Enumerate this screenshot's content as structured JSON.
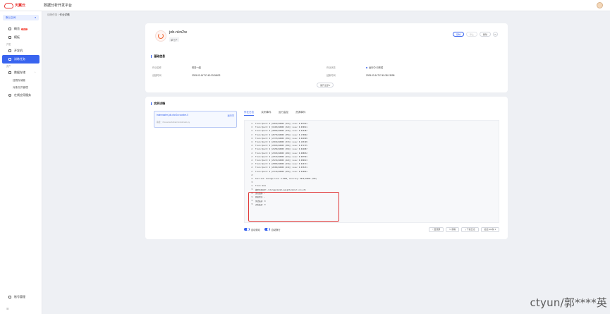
{
  "app": {
    "logo_text": "天翼云",
    "title": "数据分析开发平台"
  },
  "sidebar": {
    "workspace": "默认空间",
    "items": [
      {
        "label": "概览",
        "badge": "NEW",
        "active": false
      },
      {
        "label": "模板",
        "active": false
      },
      {
        "group": "开发"
      },
      {
        "label": "开发机",
        "active": false
      },
      {
        "label": "训练任务",
        "active": true
      },
      {
        "group": "资产"
      },
      {
        "label": "数据存储",
        "active": false,
        "expandable": true
      },
      {
        "sub": "挂载存储卷"
      },
      {
        "sub": "对象文件管理"
      },
      {
        "label": "在线应用服务",
        "active": false
      }
    ],
    "bottom_item": "账号管理",
    "collapse_label": "收起"
  },
  "breadcrumb": {
    "parent": "训练任务",
    "separator": "/",
    "current": "作业详情"
  },
  "job": {
    "name": "job-nkn2w",
    "tag": "单门户",
    "actions": {
      "copy": "复制",
      "stop": "停止",
      "delete": "删除"
    }
  },
  "basic_info": {
    "title": "基础信息",
    "rows": [
      {
        "k1": "作业名称",
        "v1": "任务一组",
        "k2": "作业状态",
        "v2": "运行中·已完成"
      },
      {
        "k1": "创建时间",
        "v1": "2025-03-14T17:43:33.08632",
        "k2": "结束时间",
        "v2": "2025-03-14T17:45:38.13098"
      }
    ],
    "expand_label": "展开全部"
  },
  "detail": {
    "title": "实例详情",
    "instance_id": "trainmaster-job-nkn2w-worker-0",
    "instance_status": "运行中",
    "instance_path": "路径：/home/work/train/mnist/main.py",
    "tabs": [
      "作业日志",
      "实例事件",
      "运行监控",
      "资源事件"
    ],
    "active_tab": 0,
    "log_lines": [
      {
        "n": "14",
        "t": "Train Epoch: 9 [18816/60000 (31%)] Loss: 0.057641"
      },
      {
        "n": "15",
        "t": "Train Epoch: 9 [19456/60000 (32%)] Loss: 0.030911"
      },
      {
        "n": "16",
        "t": "Train Epoch: 9 [20096/60000 (33%)] Loss: 0.015487"
      },
      {
        "n": "17",
        "t": "Train Epoch: 9 [20736/60000 (35%)] Loss: 0.170692"
      },
      {
        "n": "18",
        "t": "Train Epoch: 9 [21376/60000 (36%)] Loss: 0.024999"
      },
      {
        "n": "19",
        "t": "Train Epoch: 9 [22016/60000 (37%)] Loss: 0.193199"
      },
      {
        "n": "20",
        "t": "Train Epoch: 9 [22656/60000 (38%)] Loss: 0.071735"
      },
      {
        "n": "21",
        "t": "Train Epoch: 9 [23296/60000 (39%)] Loss: 0.044687"
      },
      {
        "n": "22",
        "t": "Train Epoch: 9 [23936/60000 (40%)] Loss: 0.008032"
      },
      {
        "n": "23",
        "t": "Train Epoch: 9 [24576/60000 (41%)] Loss: 0.007591"
      },
      {
        "n": "24",
        "t": "Train Epoch: 9 [25216/60000 (42%)] Loss: 0.009613"
      },
      {
        "n": "25",
        "t": "Train Epoch: 9 [25856/60000 (43%)] Loss: 0.016711"
      },
      {
        "n": "26",
        "t": "Train Epoch: 9 [26496/60000 (44%)] Loss: 0.035231"
      },
      {
        "n": "27",
        "t": "Train Epoch: 9 [27136/60000 (45%)] Loss: 0.010661"
      },
      {
        "n": "28",
        "t": ""
      },
      {
        "n": "29",
        "t": "Test set: Average loss: 0.0285, Accuracy: 9915/10000 (99%)"
      },
      {
        "n": "30",
        "t": ""
      },
      {
        "n": "31",
        "t": "Train done"
      },
      {
        "n": "32",
        "t": "模型已保存至：/storage/model/weights/mnist_cnn.pth"
      },
      {
        "n": "33",
        "t": "正在清理..."
      },
      {
        "n": "34",
        "t": "开始测试..."
      },
      {
        "n": "35",
        "t": "测试结束: 0"
      },
      {
        "n": "36",
        "t": "训练结束: 0"
      }
    ],
    "bottom": {
      "toggle1": "自动滚动",
      "toggle2": "自动换行",
      "btn_top": "回顶部",
      "btn_refresh": "刷新",
      "btn_download": "下载日志",
      "select": "最近100条"
    }
  },
  "watermark": "ctyun/郭****英"
}
